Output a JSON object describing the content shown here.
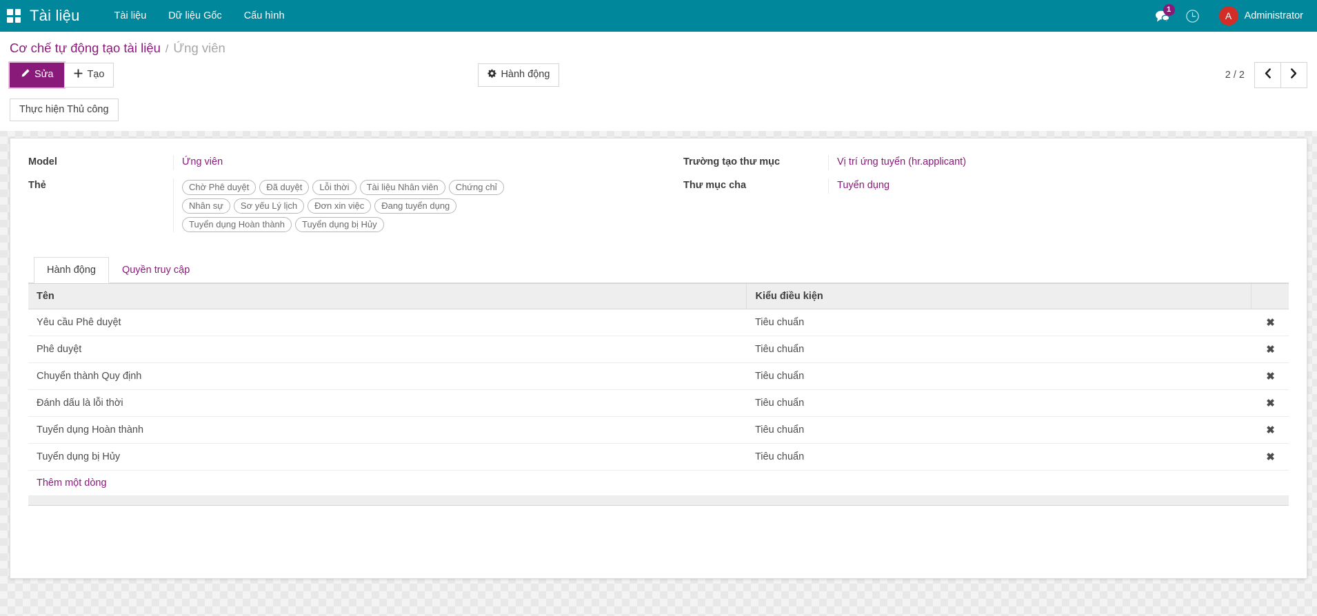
{
  "navbar": {
    "apps_icon": "apps-grid-icon",
    "brand": "Tài liệu",
    "menu": [
      {
        "label": "Tài liệu"
      },
      {
        "label": "Dữ liệu Gốc"
      },
      {
        "label": "Cấu hình"
      }
    ],
    "messages_icon": "messages-icon",
    "messages_badge": "1",
    "activity_icon": "clock-activity-icon",
    "avatar_initial": "A",
    "user_name": "Administrator",
    "bg_color": "#00879b"
  },
  "breadcrumb": {
    "parent": "Cơ chế tự động tạo tài liệu",
    "separator": "/",
    "current": "Ứng viên"
  },
  "control_panel": {
    "edit_label": "Sửa",
    "edit_icon": "pencil-icon",
    "create_label": "Tạo",
    "create_icon": "plus-icon",
    "action_label": "Hành động",
    "action_icon": "gear-icon",
    "pager_text": "2 / 2",
    "prev_icon": "chevron-left-icon",
    "next_icon": "chevron-right-icon",
    "manual_run_label": "Thực hiện Thủ công",
    "accent_color": "#8a1a7a"
  },
  "form": {
    "left": [
      {
        "label": "Model",
        "value": "Ứng viên",
        "type": "link"
      },
      {
        "label": "Thẻ",
        "type": "tags"
      }
    ],
    "tags": [
      "Chờ Phê duyệt",
      "Đã duyệt",
      "Lỗi thời",
      "Tài liệu Nhân viên",
      "Chứng chỉ",
      "Nhân sự",
      "Sơ yếu Lý lịch",
      "Đơn xin việc",
      "Đang tuyển dụng",
      "Tuyển dụng Hoàn thành",
      "Tuyển dụng bị Hủy"
    ],
    "right": [
      {
        "label": "Trường tạo thư mục",
        "value": "Vị trí ứng tuyển (hr.applicant)"
      },
      {
        "label": "Thư mục cha",
        "value": "Tuyển dụng"
      }
    ]
  },
  "notebook": {
    "tabs": [
      {
        "label": "Hành động",
        "active": true
      },
      {
        "label": "Quyền truy cập",
        "active": false
      }
    ]
  },
  "table": {
    "headers": {
      "name": "Tên",
      "condition": "Kiểu điều kiện"
    },
    "rows": [
      {
        "name": "Yêu cầu Phê duyệt",
        "condition": "Tiêu chuẩn",
        "delete_icon": "close-icon"
      },
      {
        "name": "Phê duyệt",
        "condition": "Tiêu chuẩn",
        "delete_icon": "close-icon"
      },
      {
        "name": "Chuyển thành Quy định",
        "condition": "Tiêu chuẩn",
        "delete_icon": "close-icon"
      },
      {
        "name": "Đánh dấu là lỗi thời",
        "condition": "Tiêu chuẩn",
        "delete_icon": "close-icon"
      },
      {
        "name": "Tuyển dụng Hoàn thành",
        "condition": "Tiêu chuẩn",
        "delete_icon": "close-icon"
      },
      {
        "name": "Tuyển dụng bị Hủy",
        "condition": "Tiêu chuẩn",
        "delete_icon": "close-icon"
      }
    ],
    "add_line_label": "Thêm một dòng"
  }
}
